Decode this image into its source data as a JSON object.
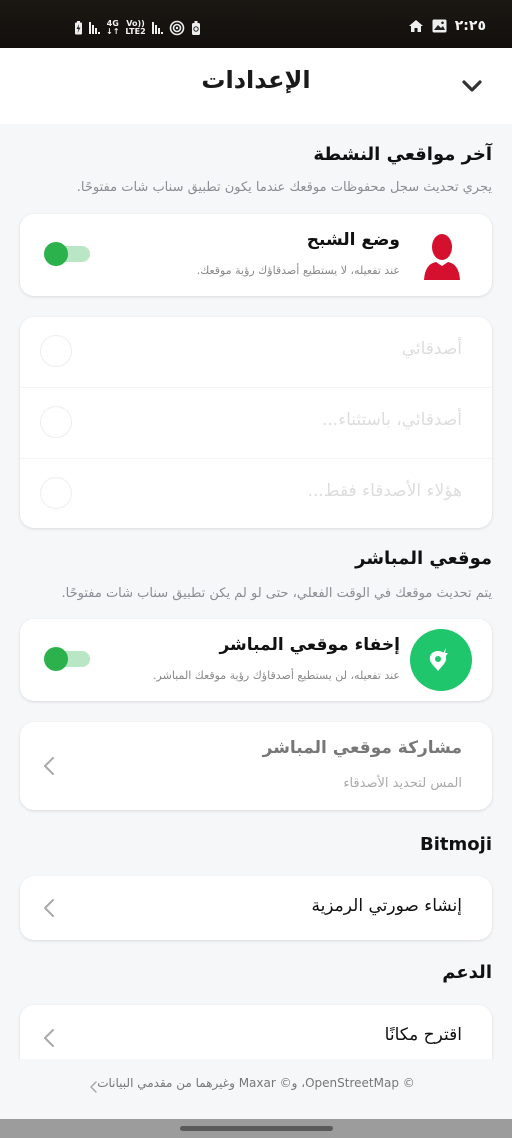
{
  "status_bar": {
    "time": "٢:٢٥",
    "network_top": "4G",
    "network_bottom": "LTE2",
    "volte": "Vo))",
    "icons": [
      "battery-charging-icon",
      "signal-icon",
      "network-4g-icon",
      "signal-icon",
      "hotspot-icon",
      "battery-saver-icon",
      "home-icon",
      "gallery-icon"
    ]
  },
  "header": {
    "title": "الإعدادات",
    "collapse_icon": "chevron-down-icon"
  },
  "sections": {
    "recent_locations": {
      "title": "آخر مواقعي النشطة",
      "description": "يجري تحديث سجل محفوظات موقعك عندما يكون تطبيق سناب شات مفتوحًا."
    },
    "ghost_mode": {
      "title": "وضع الشبح",
      "subtitle": "عند تفعيله، لا يستطيع أصدقاؤك رؤية موقعك.",
      "enabled": true,
      "icon_color": "#d50f2e"
    },
    "visibility_options": [
      {
        "label": "أصدقائي",
        "selected": false
      },
      {
        "label": "أصدقائي، باستثناء...",
        "selected": false
      },
      {
        "label": "هؤلاء الأصدقاء فقط...",
        "selected": false
      }
    ],
    "live_location": {
      "title": "موقعي المباشر",
      "description": "يتم تحديث موقعك في الوقت الفعلي، حتى لو لم يكن تطبيق سناب شات مفتوحًا."
    },
    "hide_live_location": {
      "title": "إخفاء موقعي المباشر",
      "subtitle": "عند تفعيله، لن يستطيع أصدقاؤك رؤية موقعك المباشر.",
      "enabled": true,
      "icon_color": "#1fc66b"
    },
    "share_live_location": {
      "title": "مشاركة موقعي المباشر",
      "subtitle": "المس لتحديد الأصدقاء"
    },
    "bitmoji": {
      "title": "Bitmoji",
      "item": "إنشاء صورتي الرمزية"
    },
    "support": {
      "title": "الدعم",
      "item": "اقترح مكانًا"
    }
  },
  "footer": {
    "attribution": "© OpenStreetMap، و© Maxar وغيرهما من مقدمي البيانات"
  },
  "colors": {
    "toggle_on": "#2bb24c",
    "toggle_track": "#b9e6c5",
    "background": "#f6f7f9"
  }
}
